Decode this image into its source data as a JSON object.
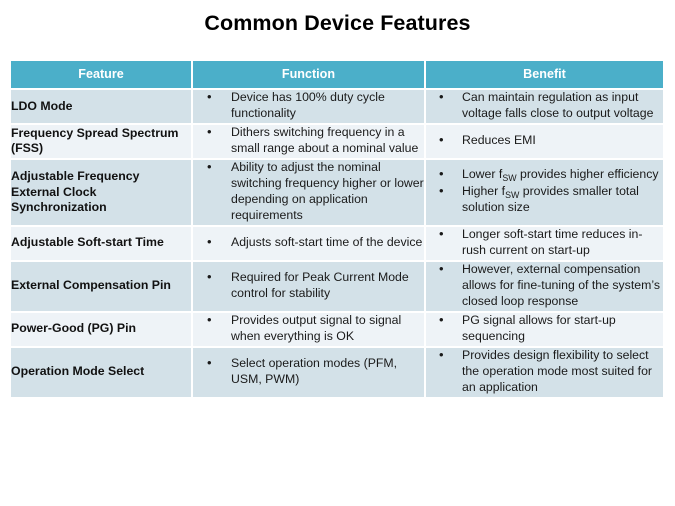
{
  "slide": {
    "title": "Common Device Features",
    "accent_color": "#4bafc9",
    "band_a_color": "#d3e1e8",
    "band_b_color": "#eef3f7",
    "background_color": "#ffffff",
    "text_color": "#1a1a1a"
  },
  "table": {
    "headers": [
      "Feature",
      "Function",
      "Benefit"
    ],
    "rows": [
      {
        "feature": "LDO Mode",
        "function": [
          "Device has 100% duty cycle functionality"
        ],
        "benefit": [
          "Can maintain regulation as input voltage falls close to output voltage"
        ]
      },
      {
        "feature": "Frequency Spread Spectrum (FSS)",
        "function": [
          "Dithers switching frequency in a small range about a nominal value"
        ],
        "benefit": [
          "Reduces EMI"
        ]
      },
      {
        "feature": "Adjustable Frequency External Clock Synchronization",
        "function": [
          "Ability to adjust the nominal switching frequency higher or lower depending on application requirements"
        ],
        "benefit": [
          "Lower fSW provides higher efficiency",
          "Higher fSW provides smaller total solution size"
        ],
        "benefit_html": [
          "Lower f<sub>SW</sub> provides higher efficiency",
          "Higher f<sub>SW</sub> provides smaller total solution size"
        ]
      },
      {
        "feature": "Adjustable  Soft-start Time",
        "function": [
          "Adjusts soft-start time of the device"
        ],
        "benefit": [
          "Longer soft-start time reduces in-rush current on start-up"
        ]
      },
      {
        "feature": "External Compensation Pin",
        "function": [
          "Required for Peak Current Mode  control for stability"
        ],
        "benefit": [
          "However, external compensation allows for fine-tuning of the system’s closed loop response"
        ]
      },
      {
        "feature": "Power-Good (PG) Pin",
        "function": [
          "Provides output signal to signal when everything is OK"
        ],
        "benefit": [
          "PG signal allows for start-up sequencing"
        ]
      },
      {
        "feature": "Operation Mode Select",
        "function": [
          "Select operation modes (PFM, USM, PWM)"
        ],
        "benefit": [
          "Provides design flexibility  to select the operation mode most suited for an application"
        ]
      }
    ]
  }
}
